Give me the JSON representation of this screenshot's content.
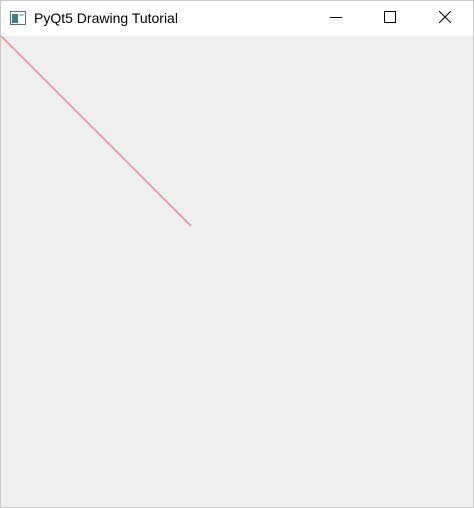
{
  "window": {
    "title": "PyQt5 Drawing Tutorial",
    "icons": {
      "app": "app-window-icon",
      "minimize": "minimize-icon",
      "maximize": "maximize-icon",
      "close": "close-icon"
    }
  },
  "canvas": {
    "background_color": "#efefef",
    "line_color": "#f07a7a"
  }
}
